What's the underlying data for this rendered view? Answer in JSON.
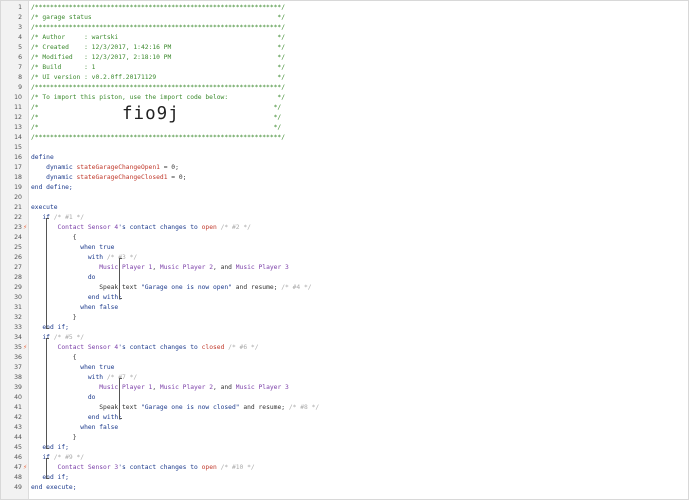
{
  "editor": {
    "import_code": "fio9j",
    "lines": [
      {
        "n": "1",
        "segs": [
          {
            "t": "/*****************************************************************/",
            "c": "c-cmt"
          }
        ]
      },
      {
        "n": "2",
        "segs": [
          {
            "t": "/* garage status                                                 */",
            "c": "c-cmt"
          }
        ]
      },
      {
        "n": "3",
        "segs": [
          {
            "t": "/*****************************************************************/",
            "c": "c-cmt"
          }
        ]
      },
      {
        "n": "4",
        "segs": [
          {
            "t": "/* Author     : wartski                                          */",
            "c": "c-cmt"
          }
        ]
      },
      {
        "n": "5",
        "segs": [
          {
            "t": "/* Created    : 12/3/2017, 1:42:16 PM                            */",
            "c": "c-cmt"
          }
        ]
      },
      {
        "n": "6",
        "segs": [
          {
            "t": "/* Modified   : 12/3/2017, 2:18:10 PM                            */",
            "c": "c-cmt"
          }
        ]
      },
      {
        "n": "7",
        "segs": [
          {
            "t": "/* Build      : 1                                                */",
            "c": "c-cmt"
          }
        ]
      },
      {
        "n": "8",
        "segs": [
          {
            "t": "/* UI version : v0.2.0ff.20171129                                */",
            "c": "c-cmt"
          }
        ]
      },
      {
        "n": "9",
        "segs": [
          {
            "t": "/*****************************************************************/",
            "c": "c-cmt"
          }
        ]
      },
      {
        "n": "10",
        "segs": [
          {
            "t": "/* To import this piston, use the import code below:             */",
            "c": "c-cmt"
          }
        ]
      },
      {
        "n": "11",
        "segs": [
          {
            "t": "/*                                                              */",
            "c": "c-cmt"
          }
        ]
      },
      {
        "n": "12",
        "segs": [
          {
            "t": "/*                                                              */",
            "c": "c-cmt"
          }
        ]
      },
      {
        "n": "13",
        "segs": [
          {
            "t": "/*                                                              */",
            "c": "c-cmt"
          }
        ]
      },
      {
        "n": "14",
        "segs": [
          {
            "t": "/*****************************************************************/",
            "c": "c-cmt"
          }
        ]
      },
      {
        "n": "15",
        "segs": []
      },
      {
        "n": "16",
        "segs": [
          {
            "t": "define",
            "c": "kw"
          }
        ]
      },
      {
        "n": "17",
        "segs": [
          {
            "t": "    dynamic ",
            "c": "kw"
          },
          {
            "t": "stateGarageChangeOpen1",
            "c": "var"
          },
          {
            "t": " = 0;",
            "c": "txt"
          }
        ]
      },
      {
        "n": "18",
        "segs": [
          {
            "t": "    dynamic ",
            "c": "kw"
          },
          {
            "t": "stateGarageChangeClosed1",
            "c": "var"
          },
          {
            "t": " = 0;",
            "c": "txt"
          }
        ]
      },
      {
        "n": "19",
        "segs": [
          {
            "t": "end define;",
            "c": "kw"
          }
        ]
      },
      {
        "n": "20",
        "segs": []
      },
      {
        "n": "21",
        "segs": [
          {
            "t": "execute",
            "c": "kw"
          }
        ]
      },
      {
        "n": "22",
        "segs": [
          {
            "t": "   if ",
            "c": "kw"
          },
          {
            "t": "/* #1 */",
            "c": "dim"
          }
        ]
      },
      {
        "n": "23",
        "mark": "⚡",
        "segs": [
          {
            "t": "       Contact Sensor 4",
            "c": "dev"
          },
          {
            "t": "'s contact changes to ",
            "c": "kw"
          },
          {
            "t": "open",
            "c": "val"
          },
          {
            "t": " /* #2 */",
            "c": "dim"
          }
        ]
      },
      {
        "n": "24",
        "segs": [
          {
            "t": "           {",
            "c": "txt"
          }
        ]
      },
      {
        "n": "25",
        "segs": [
          {
            "t": "             when true",
            "c": "kw"
          }
        ]
      },
      {
        "n": "26",
        "segs": [
          {
            "t": "               with ",
            "c": "kw"
          },
          {
            "t": "/* #3 */",
            "c": "dim"
          }
        ]
      },
      {
        "n": "27",
        "segs": [
          {
            "t": "                  Music Player 1",
            "c": "dev"
          },
          {
            "t": ", ",
            "c": "txt"
          },
          {
            "t": "Music Player 2",
            "c": "dev"
          },
          {
            "t": ", and ",
            "c": "txt"
          },
          {
            "t": "Music Player 3",
            "c": "dev"
          }
        ]
      },
      {
        "n": "28",
        "segs": [
          {
            "t": "               do",
            "c": "kw"
          }
        ]
      },
      {
        "n": "29",
        "segs": [
          {
            "t": "                  Speak text ",
            "c": "txt"
          },
          {
            "t": "\"Garage one is now open\"",
            "c": "str"
          },
          {
            "t": " and resume; ",
            "c": "txt"
          },
          {
            "t": "/* #4 */",
            "c": "dim"
          }
        ]
      },
      {
        "n": "30",
        "segs": [
          {
            "t": "               end with;",
            "c": "kw"
          }
        ]
      },
      {
        "n": "31",
        "segs": [
          {
            "t": "             when false",
            "c": "kw"
          }
        ]
      },
      {
        "n": "32",
        "segs": [
          {
            "t": "           }",
            "c": "txt"
          }
        ]
      },
      {
        "n": "33",
        "segs": [
          {
            "t": "   end if;",
            "c": "kw"
          }
        ]
      },
      {
        "n": "34",
        "segs": [
          {
            "t": "   if ",
            "c": "kw"
          },
          {
            "t": "/* #5 */",
            "c": "dim"
          }
        ]
      },
      {
        "n": "35",
        "mark": "⚡",
        "segs": [
          {
            "t": "       Contact Sensor 4",
            "c": "dev"
          },
          {
            "t": "'s contact changes to ",
            "c": "kw"
          },
          {
            "t": "closed",
            "c": "val"
          },
          {
            "t": " /* #6 */",
            "c": "dim"
          }
        ]
      },
      {
        "n": "36",
        "segs": [
          {
            "t": "           {",
            "c": "txt"
          }
        ]
      },
      {
        "n": "37",
        "segs": [
          {
            "t": "             when true",
            "c": "kw"
          }
        ]
      },
      {
        "n": "38",
        "segs": [
          {
            "t": "               with ",
            "c": "kw"
          },
          {
            "t": "/* #7 */",
            "c": "dim"
          }
        ]
      },
      {
        "n": "39",
        "segs": [
          {
            "t": "                  Music Player 1",
            "c": "dev"
          },
          {
            "t": ", ",
            "c": "txt"
          },
          {
            "t": "Music Player 2",
            "c": "dev"
          },
          {
            "t": ", and ",
            "c": "txt"
          },
          {
            "t": "Music Player 3",
            "c": "dev"
          }
        ]
      },
      {
        "n": "40",
        "segs": [
          {
            "t": "               do",
            "c": "kw"
          }
        ]
      },
      {
        "n": "41",
        "segs": [
          {
            "t": "                  Speak text ",
            "c": "txt"
          },
          {
            "t": "\"Garage one is now closed\"",
            "c": "str"
          },
          {
            "t": " and resume; ",
            "c": "txt"
          },
          {
            "t": "/* #8 */",
            "c": "dim"
          }
        ]
      },
      {
        "n": "42",
        "segs": [
          {
            "t": "               end with;",
            "c": "kw"
          }
        ]
      },
      {
        "n": "43",
        "segs": [
          {
            "t": "             when false",
            "c": "kw"
          }
        ]
      },
      {
        "n": "44",
        "segs": [
          {
            "t": "           }",
            "c": "txt"
          }
        ]
      },
      {
        "n": "45",
        "segs": [
          {
            "t": "   end if;",
            "c": "kw"
          }
        ]
      },
      {
        "n": "46",
        "segs": [
          {
            "t": "   if ",
            "c": "kw"
          },
          {
            "t": "/* #9 */",
            "c": "dim"
          }
        ]
      },
      {
        "n": "47",
        "mark": "⚡",
        "segs": [
          {
            "t": "       Contact Sensor 3",
            "c": "dev"
          },
          {
            "t": "'s contact changes to ",
            "c": "kw"
          },
          {
            "t": "open",
            "c": "val"
          },
          {
            "t": " /* #10 */",
            "c": "dim"
          }
        ]
      },
      {
        "n": "48",
        "segs": [
          {
            "t": "   end if;",
            "c": "kw"
          }
        ]
      },
      {
        "n": "49",
        "segs": [
          {
            "t": "end execute;",
            "c": "kw"
          }
        ]
      }
    ]
  }
}
